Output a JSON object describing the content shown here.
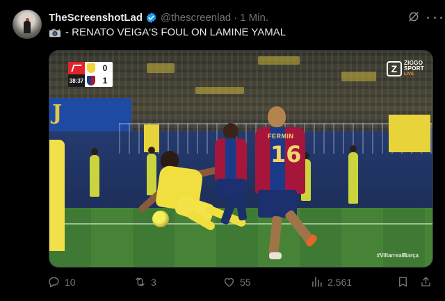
{
  "tweet": {
    "author": {
      "display_name": "TheScreenshotLad",
      "handle": "@thescreenlad",
      "verified": true,
      "avatar": "avatar"
    },
    "separator": "·",
    "timestamp": "1 Min.",
    "text_icon": "camera-flash-icon",
    "text": "- RENATO VEIGA'S FOUL ON LAMINE YAMAL"
  },
  "media": {
    "scoreboard": {
      "clock": "38:37",
      "home_score": "0",
      "away_score": "1"
    },
    "broadcaster": {
      "logo_letter": "Z",
      "line1": "ZIGGO",
      "line2": "SPORT",
      "line3": "LIVE"
    },
    "player_name": "FERMIN",
    "player_number": "16",
    "hashtag": "#VillarrealBarça"
  },
  "actions": {
    "replies": "10",
    "reposts": "3",
    "likes": "55",
    "views": "2.561"
  },
  "colors": {
    "background": "#000000",
    "text_primary": "#e7e9ea",
    "text_secondary": "#71767b",
    "verified": "#1d9bf0"
  }
}
